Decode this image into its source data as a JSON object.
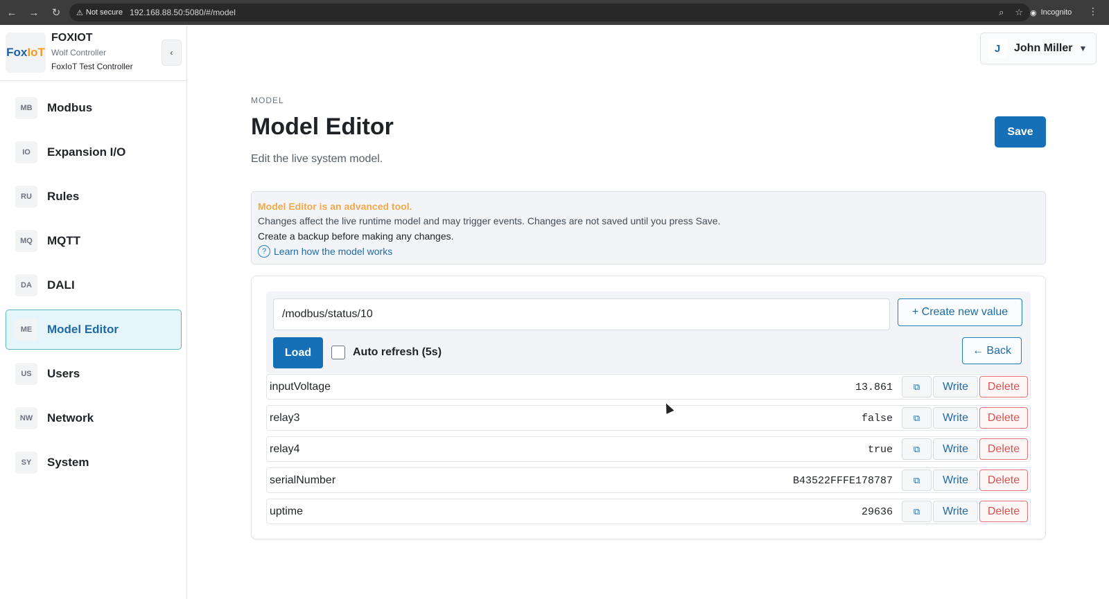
{
  "browser": {
    "security_label": "Not secure",
    "url": "192.168.88.50:5080/#/model",
    "incognito_label": "Incognito"
  },
  "brand": {
    "logo_text_a": "Fox",
    "logo_text_b": "IoT",
    "name": "FOXIOT",
    "subtitle": "Wolf Controller",
    "device": "FoxIoT Test Controller",
    "collapse_glyph": "‹"
  },
  "sidebar": {
    "items": [
      {
        "abbr": "MB",
        "label": "Modbus"
      },
      {
        "abbr": "IO",
        "label": "Expansion I/O"
      },
      {
        "abbr": "RU",
        "label": "Rules"
      },
      {
        "abbr": "MQ",
        "label": "MQTT"
      },
      {
        "abbr": "DA",
        "label": "DALI"
      },
      {
        "abbr": "ME",
        "label": "Model Editor"
      },
      {
        "abbr": "US",
        "label": "Users"
      },
      {
        "abbr": "NW",
        "label": "Network"
      },
      {
        "abbr": "SY",
        "label": "System"
      }
    ],
    "active_index": 5
  },
  "user": {
    "initial": "J",
    "name": "John Miller"
  },
  "page": {
    "breadcrumb": "MODEL",
    "title": "Model Editor",
    "subtitle": "Edit the live system model.",
    "save_label": "Save"
  },
  "warning": {
    "title": "Model Editor is an advanced tool.",
    "line1": "Changes affect the live runtime model and may trigger events. Changes are not saved until you press Save.",
    "line2": "Create a backup before making any changes.",
    "link": "Learn how the model works"
  },
  "editor": {
    "path_value": "/modbus/status/10",
    "create_label": "+ Create new value",
    "load_label": "Load",
    "auto_refresh_label": "Auto refresh (5s)",
    "back_label": "← Back",
    "write_label": "Write",
    "delete_label": "Delete",
    "rows": [
      {
        "key": "inputVoltage",
        "value": "13.861"
      },
      {
        "key": "relay3",
        "value": "false"
      },
      {
        "key": "relay4",
        "value": "true"
      },
      {
        "key": "serialNumber",
        "value": "B43522FFFE178787"
      },
      {
        "key": "uptime",
        "value": "29636"
      }
    ]
  },
  "colors": {
    "accent": "#1570b8",
    "warning_title": "#f0a94a",
    "delete": "#d9534f",
    "active_nav_bg": "#e6f5f9"
  }
}
